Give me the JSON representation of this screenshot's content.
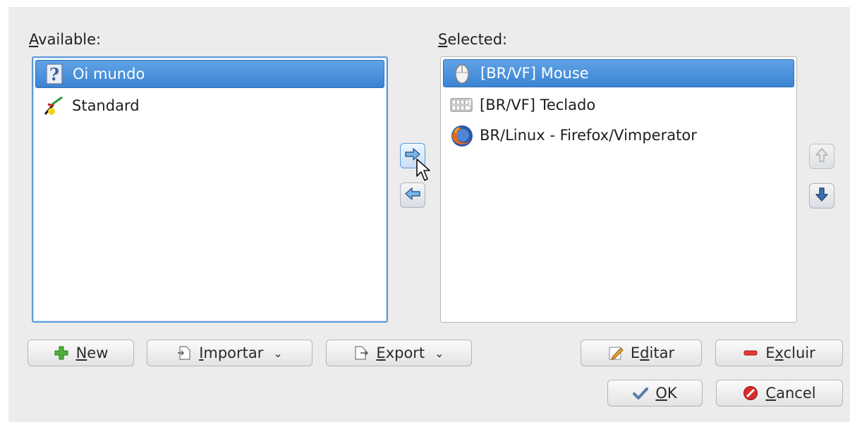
{
  "available": {
    "label_prefix": "",
    "label_accel": "A",
    "label_rest": "vailable:",
    "items": [
      {
        "text": "Oi mundo",
        "icon": "question-icon",
        "selected": true
      },
      {
        "text": "Standard",
        "icon": "standard-scheme-icon",
        "selected": false
      }
    ]
  },
  "selected": {
    "label_accel": "S",
    "label_rest": "elected:",
    "items": [
      {
        "text": "[BR/VF] Mouse",
        "icon": "mouse-icon",
        "selected": true
      },
      {
        "text": "[BR/VF] Teclado",
        "icon": "keyboard-icon",
        "selected": false
      },
      {
        "text": "BR/Linux - Firefox/Vimperator",
        "icon": "firefox-icon",
        "selected": false
      }
    ]
  },
  "buttons": {
    "new": {
      "accel": "N",
      "rest": "ew"
    },
    "importar": {
      "accel": "I",
      "rest": "mportar",
      "caret": "⌄"
    },
    "export": {
      "accel": "E",
      "rest": "xport",
      "caret": "⌄"
    },
    "editar": {
      "pre": "E",
      "accel": "d",
      "rest": "itar"
    },
    "excluir": {
      "pre": "E",
      "accel": "x",
      "rest": "cluir"
    },
    "ok": {
      "accel": "O",
      "rest": "K"
    },
    "cancel": {
      "accel": "C",
      "rest": "ancel"
    }
  },
  "colors": {
    "selection": "#3b84d3",
    "focus_border": "#5b9ad8",
    "dialog_bg": "#ececec"
  }
}
